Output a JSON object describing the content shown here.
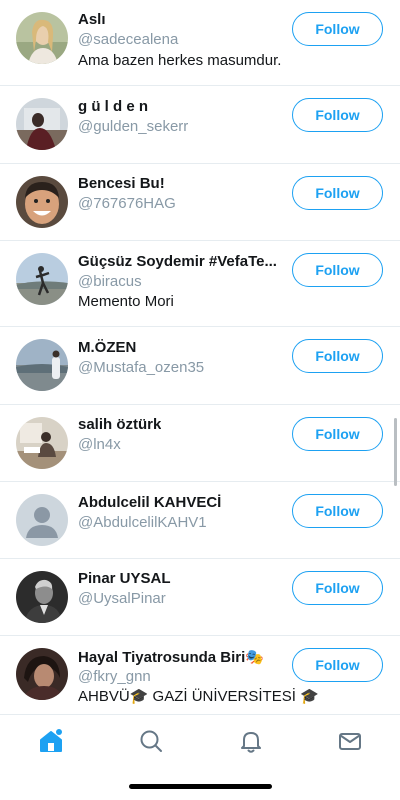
{
  "users": [
    {
      "name": "Aslı",
      "handle": "@sadecealena",
      "bio": "Ama bazen herkes masumdur.",
      "follow_label": "Follow"
    },
    {
      "name": "g ü l d e n",
      "handle": "@gulden_sekerr",
      "bio": "",
      "follow_label": "Follow"
    },
    {
      "name": "Bencesi Bu!",
      "handle": "@767676HAG",
      "bio": "",
      "follow_label": "Follow"
    },
    {
      "name": "Güçsüz Soydemir #VefaTe...",
      "handle": "@biracus",
      "bio": "Memento Mori",
      "follow_label": "Follow"
    },
    {
      "name": "M.ÖZEN",
      "handle": "@Mustafa_ozen35",
      "bio": "",
      "follow_label": "Follow"
    },
    {
      "name": "salih öztürk",
      "handle": "@ln4x",
      "bio": "",
      "follow_label": "Follow"
    },
    {
      "name": "Abdulcelil KAHVECİ",
      "handle": "@AbdulcelilKAHV1",
      "bio": "",
      "follow_label": "Follow"
    },
    {
      "name": "Pinar UYSAL",
      "handle": "@UysalPinar",
      "bio": "",
      "follow_label": "Follow"
    },
    {
      "name": "Hayal Tiyatrosunda Biri🎭",
      "handle": "@fkry_gnn",
      "bio": "AHBVÜ🎓 GAZİ ÜNİVERSİTESİ 🎓",
      "follow_label": "Follow"
    }
  ],
  "tabbar": {
    "tabs": [
      {
        "icon": "home-icon",
        "active": true
      },
      {
        "icon": "search-icon",
        "active": false
      },
      {
        "icon": "bell-icon",
        "active": false
      },
      {
        "icon": "mail-icon",
        "active": false
      }
    ]
  },
  "colors": {
    "accent": "#1da1f2",
    "secondary_text": "#8899a6",
    "primary_text": "#14171a",
    "divider": "#e6ecf0"
  }
}
